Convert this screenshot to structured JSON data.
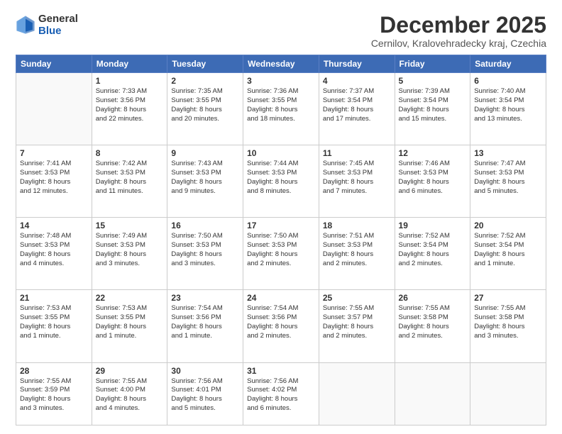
{
  "logo": {
    "text_general": "General",
    "text_blue": "Blue"
  },
  "header": {
    "month_title": "December 2025",
    "subtitle": "Cernilov, Kralovehradecky kraj, Czechia"
  },
  "weekdays": [
    "Sunday",
    "Monday",
    "Tuesday",
    "Wednesday",
    "Thursday",
    "Friday",
    "Saturday"
  ],
  "weeks": [
    [
      {
        "day": "",
        "info": ""
      },
      {
        "day": "1",
        "info": "Sunrise: 7:33 AM\nSunset: 3:56 PM\nDaylight: 8 hours\nand 22 minutes."
      },
      {
        "day": "2",
        "info": "Sunrise: 7:35 AM\nSunset: 3:55 PM\nDaylight: 8 hours\nand 20 minutes."
      },
      {
        "day": "3",
        "info": "Sunrise: 7:36 AM\nSunset: 3:55 PM\nDaylight: 8 hours\nand 18 minutes."
      },
      {
        "day": "4",
        "info": "Sunrise: 7:37 AM\nSunset: 3:54 PM\nDaylight: 8 hours\nand 17 minutes."
      },
      {
        "day": "5",
        "info": "Sunrise: 7:39 AM\nSunset: 3:54 PM\nDaylight: 8 hours\nand 15 minutes."
      },
      {
        "day": "6",
        "info": "Sunrise: 7:40 AM\nSunset: 3:54 PM\nDaylight: 8 hours\nand 13 minutes."
      }
    ],
    [
      {
        "day": "7",
        "info": "Sunrise: 7:41 AM\nSunset: 3:53 PM\nDaylight: 8 hours\nand 12 minutes."
      },
      {
        "day": "8",
        "info": "Sunrise: 7:42 AM\nSunset: 3:53 PM\nDaylight: 8 hours\nand 11 minutes."
      },
      {
        "day": "9",
        "info": "Sunrise: 7:43 AM\nSunset: 3:53 PM\nDaylight: 8 hours\nand 9 minutes."
      },
      {
        "day": "10",
        "info": "Sunrise: 7:44 AM\nSunset: 3:53 PM\nDaylight: 8 hours\nand 8 minutes."
      },
      {
        "day": "11",
        "info": "Sunrise: 7:45 AM\nSunset: 3:53 PM\nDaylight: 8 hours\nand 7 minutes."
      },
      {
        "day": "12",
        "info": "Sunrise: 7:46 AM\nSunset: 3:53 PM\nDaylight: 8 hours\nand 6 minutes."
      },
      {
        "day": "13",
        "info": "Sunrise: 7:47 AM\nSunset: 3:53 PM\nDaylight: 8 hours\nand 5 minutes."
      }
    ],
    [
      {
        "day": "14",
        "info": "Sunrise: 7:48 AM\nSunset: 3:53 PM\nDaylight: 8 hours\nand 4 minutes."
      },
      {
        "day": "15",
        "info": "Sunrise: 7:49 AM\nSunset: 3:53 PM\nDaylight: 8 hours\nand 3 minutes."
      },
      {
        "day": "16",
        "info": "Sunrise: 7:50 AM\nSunset: 3:53 PM\nDaylight: 8 hours\nand 3 minutes."
      },
      {
        "day": "17",
        "info": "Sunrise: 7:50 AM\nSunset: 3:53 PM\nDaylight: 8 hours\nand 2 minutes."
      },
      {
        "day": "18",
        "info": "Sunrise: 7:51 AM\nSunset: 3:53 PM\nDaylight: 8 hours\nand 2 minutes."
      },
      {
        "day": "19",
        "info": "Sunrise: 7:52 AM\nSunset: 3:54 PM\nDaylight: 8 hours\nand 2 minutes."
      },
      {
        "day": "20",
        "info": "Sunrise: 7:52 AM\nSunset: 3:54 PM\nDaylight: 8 hours\nand 1 minute."
      }
    ],
    [
      {
        "day": "21",
        "info": "Sunrise: 7:53 AM\nSunset: 3:55 PM\nDaylight: 8 hours\nand 1 minute."
      },
      {
        "day": "22",
        "info": "Sunrise: 7:53 AM\nSunset: 3:55 PM\nDaylight: 8 hours\nand 1 minute."
      },
      {
        "day": "23",
        "info": "Sunrise: 7:54 AM\nSunset: 3:56 PM\nDaylight: 8 hours\nand 1 minute."
      },
      {
        "day": "24",
        "info": "Sunrise: 7:54 AM\nSunset: 3:56 PM\nDaylight: 8 hours\nand 2 minutes."
      },
      {
        "day": "25",
        "info": "Sunrise: 7:55 AM\nSunset: 3:57 PM\nDaylight: 8 hours\nand 2 minutes."
      },
      {
        "day": "26",
        "info": "Sunrise: 7:55 AM\nSunset: 3:58 PM\nDaylight: 8 hours\nand 2 minutes."
      },
      {
        "day": "27",
        "info": "Sunrise: 7:55 AM\nSunset: 3:58 PM\nDaylight: 8 hours\nand 3 minutes."
      }
    ],
    [
      {
        "day": "28",
        "info": "Sunrise: 7:55 AM\nSunset: 3:59 PM\nDaylight: 8 hours\nand 3 minutes."
      },
      {
        "day": "29",
        "info": "Sunrise: 7:55 AM\nSunset: 4:00 PM\nDaylight: 8 hours\nand 4 minutes."
      },
      {
        "day": "30",
        "info": "Sunrise: 7:56 AM\nSunset: 4:01 PM\nDaylight: 8 hours\nand 5 minutes."
      },
      {
        "day": "31",
        "info": "Sunrise: 7:56 AM\nSunset: 4:02 PM\nDaylight: 8 hours\nand 6 minutes."
      },
      {
        "day": "",
        "info": ""
      },
      {
        "day": "",
        "info": ""
      },
      {
        "day": "",
        "info": ""
      }
    ]
  ]
}
